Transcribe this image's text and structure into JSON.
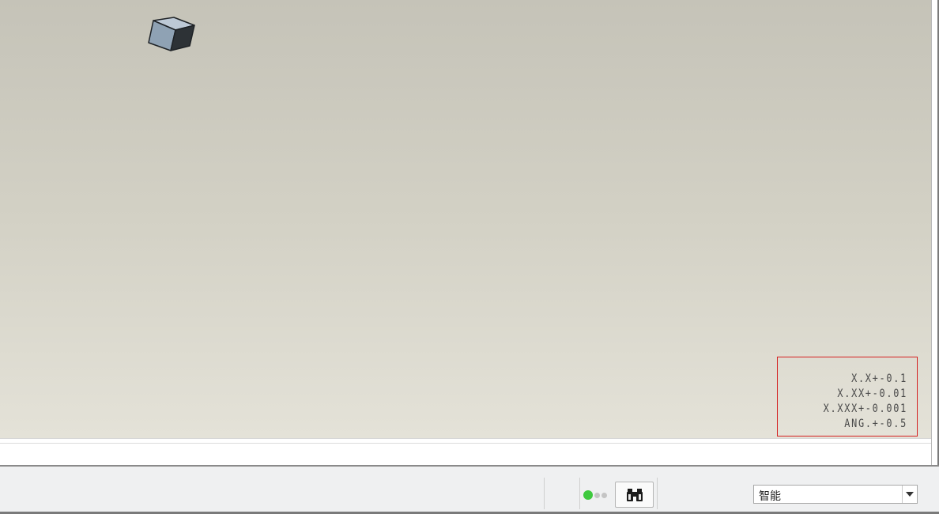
{
  "viewport": {
    "tolerance_table": {
      "lines": [
        "X.X+-0.1",
        "X.XX+-0.01",
        "X.XXX+-0.001",
        "ANG.+-0.5"
      ]
    },
    "orientation_icon": "view-cube-icon"
  },
  "status_bar": {
    "indicator_icon": "status-dots-icon",
    "find_icon": "binoculars-icon",
    "filter_select": {
      "value": "智能",
      "arrow_icon": "chevron-down-icon"
    }
  },
  "colors": {
    "tolerance_border": "#d42020",
    "status_green": "#3ec93e",
    "viewport_top": "#c5c3b8",
    "viewport_bottom": "#e4e2d8"
  }
}
